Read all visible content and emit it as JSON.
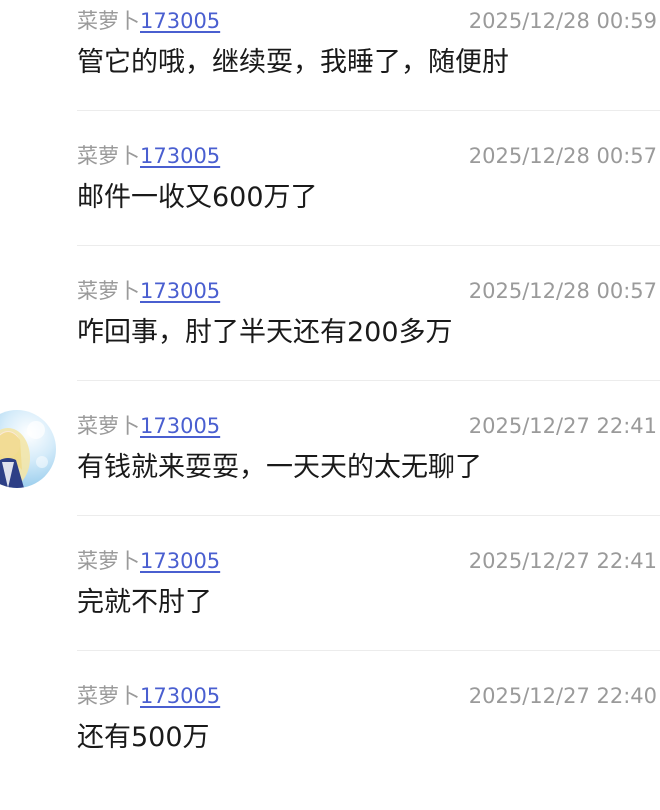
{
  "comments": [
    {
      "author_name": "菜萝卜",
      "author_id": "173005",
      "time": "2025/12/28 00:59",
      "text": "管它的哦，继续耍，我睡了，随便肘",
      "has_avatar": false
    },
    {
      "author_name": "菜萝卜",
      "author_id": "173005",
      "time": "2025/12/28 00:57",
      "text": "邮件一收又600万了",
      "has_avatar": false
    },
    {
      "author_name": "菜萝卜",
      "author_id": "173005",
      "time": "2025/12/28 00:57",
      "text": "咋回事，肘了半天还有200多万",
      "has_avatar": false
    },
    {
      "author_name": "菜萝卜",
      "author_id": "173005",
      "time": "2025/12/27 22:41",
      "text": "有钱就来耍耍，一天天的太无聊了",
      "has_avatar": true
    },
    {
      "author_name": "菜萝卜",
      "author_id": "173005",
      "time": "2025/12/27 22:41",
      "text": "完就不肘了",
      "has_avatar": false
    },
    {
      "author_name": "菜萝卜",
      "author_id": "173005",
      "time": "2025/12/27 22:40",
      "text": "还有500万",
      "has_avatar": false
    }
  ],
  "colors": {
    "author_link": "#4a5fd0",
    "meta_text": "#9a9a9a",
    "body_text": "#1a1a1a",
    "divider": "#ececec"
  },
  "icons": {
    "avatar": "user-avatar-anime-girl"
  }
}
